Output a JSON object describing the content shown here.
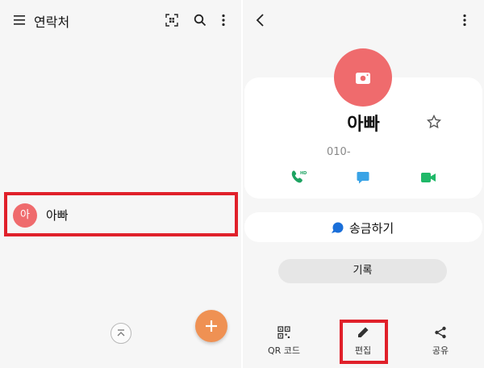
{
  "contacts_list": {
    "title": "연락처",
    "items": [
      {
        "avatar_letter": "아",
        "name": "아빠"
      }
    ]
  },
  "contact_detail": {
    "name": "아빠",
    "phone": "010-",
    "call_badge": "HD",
    "send_money_label": "송금하기",
    "history_label": "기록",
    "actions": {
      "qr_label": "QR 코드",
      "edit_label": "편집",
      "share_label": "공유"
    }
  },
  "colors": {
    "avatar": "#ef6b6d",
    "fab": "#ef9153",
    "highlight": "#e0202a",
    "call_green": "#1ea362",
    "message_blue": "#39a3e6",
    "video_green": "#1fb868",
    "pay_blue": "#1a6fd9"
  },
  "icons": [
    "menu-icon",
    "qr-scan-icon",
    "search-icon",
    "more-options-icon",
    "back-arrow-icon",
    "star-icon",
    "camera-icon",
    "phone-icon",
    "message-icon",
    "video-call-icon",
    "plus-icon",
    "chevron-up-icon",
    "qr-code-icon",
    "pencil-icon",
    "share-icon",
    "pay-icon"
  ]
}
